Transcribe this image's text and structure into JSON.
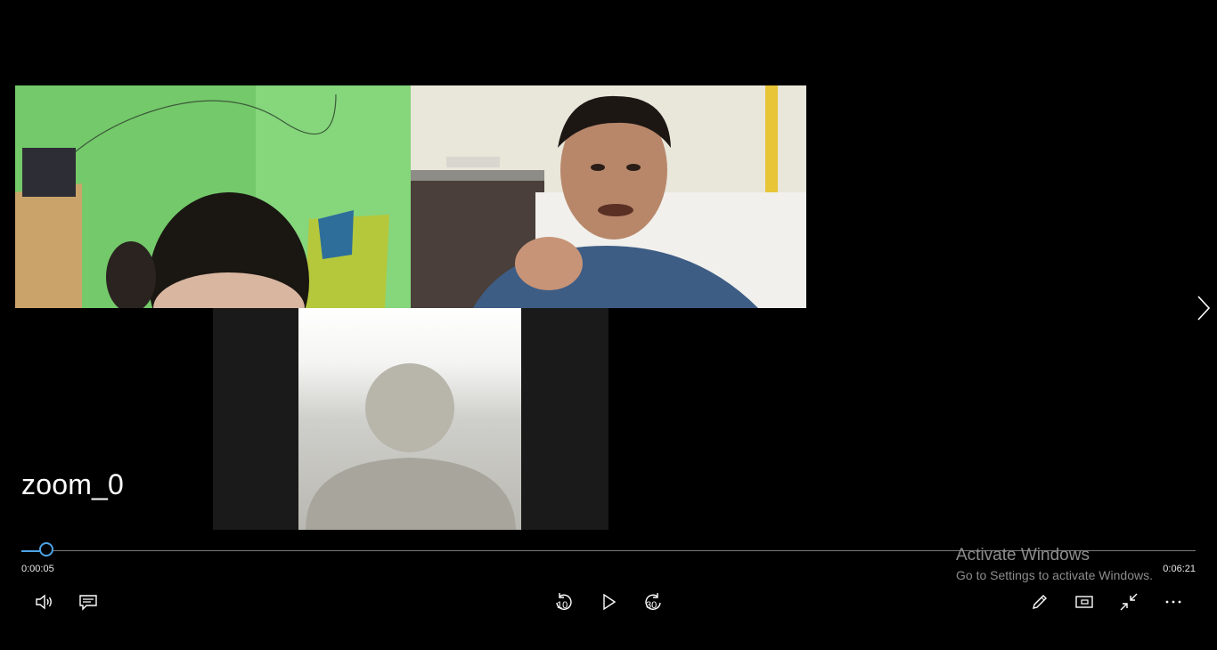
{
  "video": {
    "title": "zoom_0",
    "current_time": "0:00:05",
    "total_time": "0:06:21",
    "progress": 0.021
  },
  "participants": [
    {
      "name": "participant-tile-1",
      "background": "#74c96a"
    },
    {
      "name": "participant-tile-2",
      "background": "#e9e6da"
    },
    {
      "name": "participant-tile-3",
      "background": "#f2f2ef"
    }
  ],
  "controls": {
    "left": [
      "volume-icon",
      "captions-icon"
    ],
    "center": [
      {
        "icon": "skip-back-icon",
        "label": "10"
      },
      {
        "icon": "play-icon"
      },
      {
        "icon": "skip-forward-icon",
        "label": "30"
      }
    ],
    "right": [
      "pencil-icon",
      "mini-view-icon",
      "exit-fullscreen-icon",
      "more-icon"
    ]
  },
  "watermark": {
    "title": "Activate Windows",
    "subtitle": "Go to Settings to activate Windows."
  },
  "colors": {
    "accent": "#4da3e6",
    "background": "#000000"
  }
}
